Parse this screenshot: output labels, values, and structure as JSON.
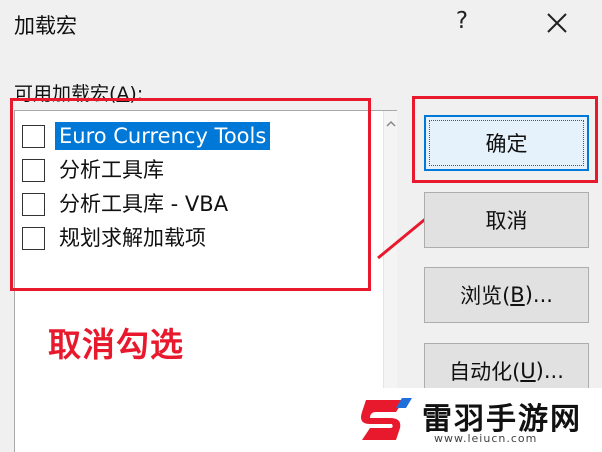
{
  "dialog": {
    "title": "加载宏",
    "help_label": "?",
    "list_label_prefix": "可用加载宏(",
    "list_label_accel": "A",
    "list_label_suffix": "):"
  },
  "addins": [
    {
      "label": "Euro Currency Tools",
      "checked": false,
      "selected": true
    },
    {
      "label": "分析工具库",
      "checked": false,
      "selected": false
    },
    {
      "label": "分析工具库 - VBA",
      "checked": false,
      "selected": false
    },
    {
      "label": "规划求解加载项",
      "checked": false,
      "selected": false
    }
  ],
  "buttons": {
    "ok": "确定",
    "cancel": "取消",
    "browse_prefix": "浏览(",
    "browse_accel": "B",
    "browse_suffix": ")...",
    "automation_prefix": "自动化(",
    "automation_accel": "U",
    "automation_suffix": ")..."
  },
  "annotation": {
    "text": "取消勾选",
    "color": "#e8192c"
  },
  "watermark": {
    "name": "雷羽手游网",
    "url": "www.leiucn.com"
  },
  "colors": {
    "selection": "#0078d7",
    "dialog_bg": "#f0f0f0"
  }
}
